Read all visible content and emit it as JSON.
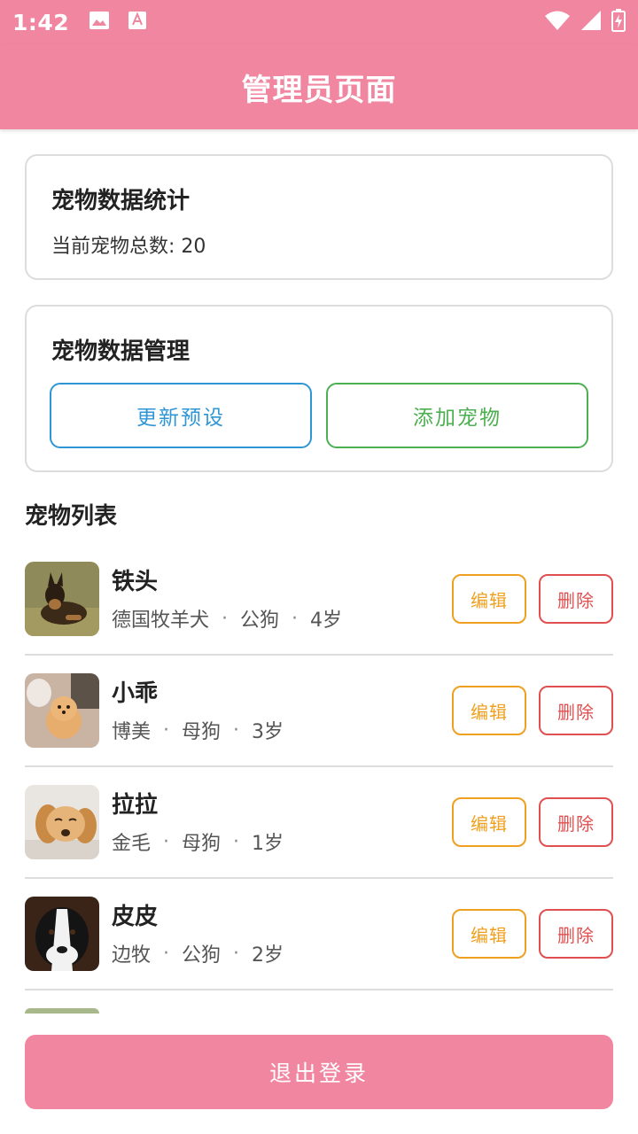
{
  "status_bar": {
    "time": "1:42",
    "icons": [
      "image-icon",
      "text-icon",
      "wifi-icon",
      "signal-icon",
      "battery-charging-icon"
    ]
  },
  "app_bar": {
    "title": "管理员页面"
  },
  "stats_card": {
    "title": "宠物数据统计",
    "total_label": "当前宠物总数: 20"
  },
  "manage_card": {
    "title": "宠物数据管理",
    "update_label": "更新预设",
    "add_label": "添加宠物"
  },
  "pet_list": {
    "title": "宠物列表",
    "edit_label": "编辑",
    "delete_label": "删除",
    "separator": "·",
    "items": [
      {
        "name": "铁头",
        "breed": "德国牧羊犬",
        "gender": "公狗",
        "age": "4岁"
      },
      {
        "name": "小乖",
        "breed": "博美",
        "gender": "母狗",
        "age": "3岁"
      },
      {
        "name": "拉拉",
        "breed": "金毛",
        "gender": "母狗",
        "age": "1岁"
      },
      {
        "name": "皮皮",
        "breed": "边牧",
        "gender": "公狗",
        "age": "2岁"
      }
    ]
  },
  "logout_label": "退出登录",
  "colors": {
    "primary": "#f086a0",
    "update_blue": "#2f96d6",
    "add_green": "#4caf50",
    "edit_orange": "#f0a020",
    "delete_red": "#e05050"
  }
}
